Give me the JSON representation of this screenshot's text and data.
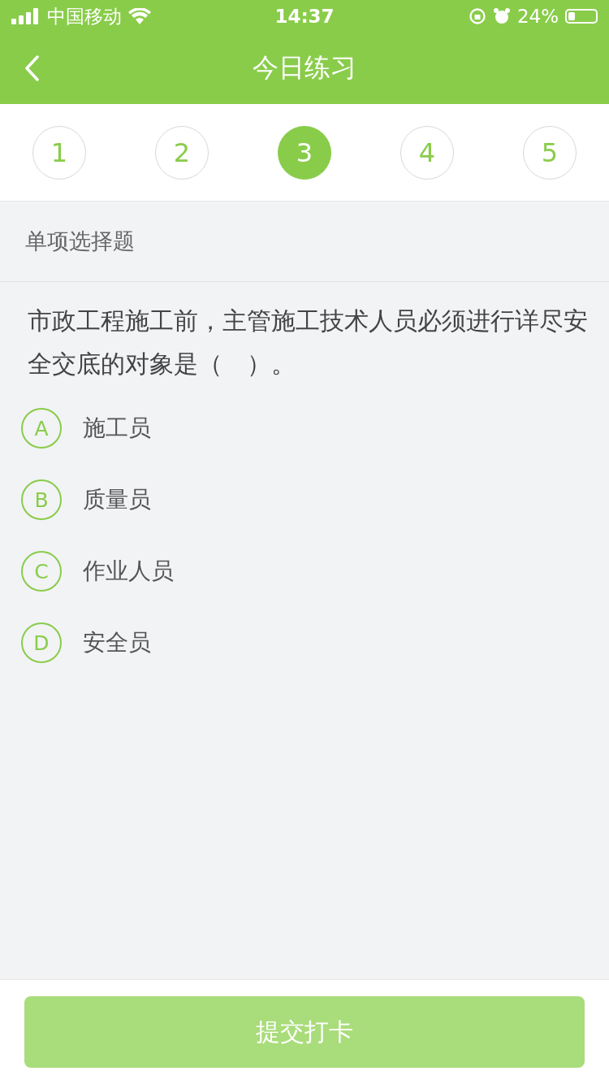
{
  "status_bar": {
    "carrier": "中国移动",
    "time": "14:37",
    "battery": "24%"
  },
  "header": {
    "title": "今日练习"
  },
  "steps": [
    {
      "label": "1",
      "selected": false
    },
    {
      "label": "2",
      "selected": false
    },
    {
      "label": "3",
      "selected": true
    },
    {
      "label": "4",
      "selected": false
    },
    {
      "label": "5",
      "selected": false
    }
  ],
  "question_type": "单项选择题",
  "question": "市政工程施工前，主管施工技术人员必须进行详尽安全交底的对象是（　）。",
  "options": [
    {
      "letter": "A",
      "text": "施工员",
      "selected": false
    },
    {
      "letter": "B",
      "text": "质量员",
      "selected": false
    },
    {
      "letter": "C",
      "text": "作业人员",
      "selected": false
    },
    {
      "letter": "D",
      "text": "安全员",
      "selected": false
    }
  ],
  "submit_button": {
    "label": "提交打卡",
    "disabled": true
  }
}
